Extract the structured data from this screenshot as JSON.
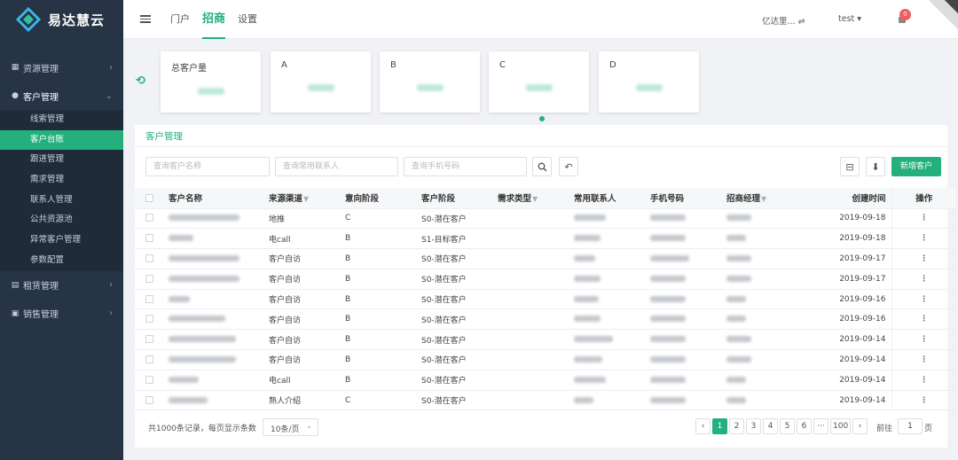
{
  "app": {
    "name": "易达慧云"
  },
  "sidebar": {
    "groups": [
      {
        "label": "资源管理",
        "icon": "grid-icon"
      },
      {
        "label": "客户管理",
        "icon": "user-icon"
      },
      {
        "label": "租赁管理",
        "icon": "doc-icon"
      },
      {
        "label": "销售管理",
        "icon": "wallet-icon"
      }
    ],
    "sub_items": [
      "线索管理",
      "客户台账",
      "跟进管理",
      "需求管理",
      "联系人管理",
      "公共资源池",
      "异常客户管理",
      "参数配置"
    ]
  },
  "topbar": {
    "tabs": [
      "门户",
      "招商",
      "设置"
    ],
    "tenant": "亿达里... ⇌",
    "user": "test ▾",
    "badge": "0"
  },
  "stats": {
    "cards": [
      {
        "label": "总客户量"
      },
      {
        "label": "A"
      },
      {
        "label": "B"
      },
      {
        "label": "C"
      },
      {
        "label": "D"
      }
    ]
  },
  "panel": {
    "title": "客户管理",
    "search": {
      "name_placeholder": "查询客户名称",
      "contact_placeholder": "查询常用联系人",
      "phone_placeholder": "查询手机号码"
    },
    "new_button": "新增客户",
    "columns": [
      "客户名称",
      "来源渠道",
      "意向阶段",
      "客户阶段",
      "需求类型",
      "常用联系人",
      "手机号码",
      "招商经理",
      "创建时间",
      "操作"
    ],
    "rows": [
      {
        "source": "地推",
        "intent": "C",
        "stage": "S0-潜在客户",
        "date": "2019-09-18"
      },
      {
        "source": "电call",
        "intent": "B",
        "stage": "S1-目标客户",
        "date": "2019-09-18"
      },
      {
        "source": "客户自访",
        "intent": "B",
        "stage": "S0-潜在客户",
        "date": "2019-09-17"
      },
      {
        "source": "客户自访",
        "intent": "B",
        "stage": "S0-潜在客户",
        "date": "2019-09-17"
      },
      {
        "source": "客户自访",
        "intent": "B",
        "stage": "S0-潜在客户",
        "date": "2019-09-16"
      },
      {
        "source": "客户自访",
        "intent": "B",
        "stage": "S0-潜在客户",
        "date": "2019-09-16"
      },
      {
        "source": "客户自访",
        "intent": "B",
        "stage": "S0-潜在客户",
        "date": "2019-09-14"
      },
      {
        "source": "客户自访",
        "intent": "B",
        "stage": "S0-潜在客户",
        "date": "2019-09-14"
      },
      {
        "source": "电call",
        "intent": "B",
        "stage": "S0-潜在客户",
        "date": "2019-09-14"
      },
      {
        "source": "熟人介绍",
        "intent": "C",
        "stage": "S0-潜在客户",
        "date": "2019-09-14"
      }
    ],
    "footer": {
      "summary": "共1000条记录，每页显示条数",
      "page_size": "10条/页",
      "pages": [
        "1",
        "2",
        "3",
        "4",
        "5",
        "6",
        "···",
        "100"
      ],
      "goto_label": "前往",
      "goto_value": "1",
      "goto_suffix": "页"
    }
  },
  "colors": {
    "accent": "#23b07d",
    "sidebar_bg": "#263445"
  }
}
